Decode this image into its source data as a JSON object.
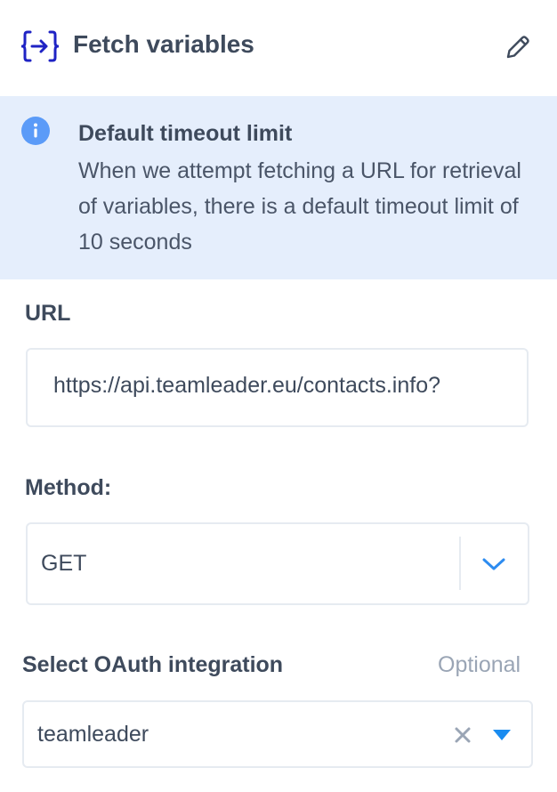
{
  "header": {
    "title": "Fetch variables",
    "icon": "fetch-variables-icon",
    "edit_icon": "pencil-icon",
    "icon_color": "#1f23c4"
  },
  "banner": {
    "icon": "info-icon",
    "title": "Default timeout limit",
    "body": "When we attempt fetching a URL for retrieval of variables, there is a default timeout limit of 10 seconds",
    "background": "#e5eefc",
    "icon_color": "#5b9bf8"
  },
  "url": {
    "label": "URL",
    "value": "https://api.teamleader.eu/contacts.info?"
  },
  "method": {
    "label": "Method:",
    "value": "GET",
    "chevron_icon": "chevron-down-icon",
    "accent": "#2d8cf0"
  },
  "oauth": {
    "label": "Select OAuth integration",
    "optional": "Optional",
    "value": "teamleader",
    "clear_icon": "close-icon",
    "caret_icon": "caret-down-icon",
    "accent": "#1a8cf0"
  }
}
